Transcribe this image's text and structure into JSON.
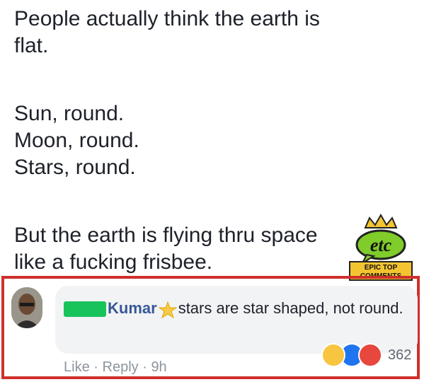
{
  "post": {
    "line1": "People actually think the earth is",
    "line2": "flat.",
    "line3": "Sun, round.",
    "line4": "Moon, round.",
    "line5": "Stars, round.",
    "line6": "But the earth is flying thru space",
    "line7": "like a fucking frisbee."
  },
  "watermark": {
    "logo_text": "etc",
    "caption_line1": "EPIC TOP",
    "caption_line2": "COMMENTS"
  },
  "comment": {
    "author": "Kumar",
    "text": "stars are star shaped, not round.",
    "actions": {
      "like": "Like",
      "separator": "·",
      "reply": "Reply",
      "time": "9h"
    },
    "reactions": {
      "icons": [
        "haha-icon",
        "like-icon",
        "angry-icon"
      ],
      "count": "362"
    }
  },
  "colors": {
    "frame": "#cf2f2b",
    "name": "#385898",
    "redaction": "#19c35b",
    "bubble": "#f2f3f5"
  }
}
